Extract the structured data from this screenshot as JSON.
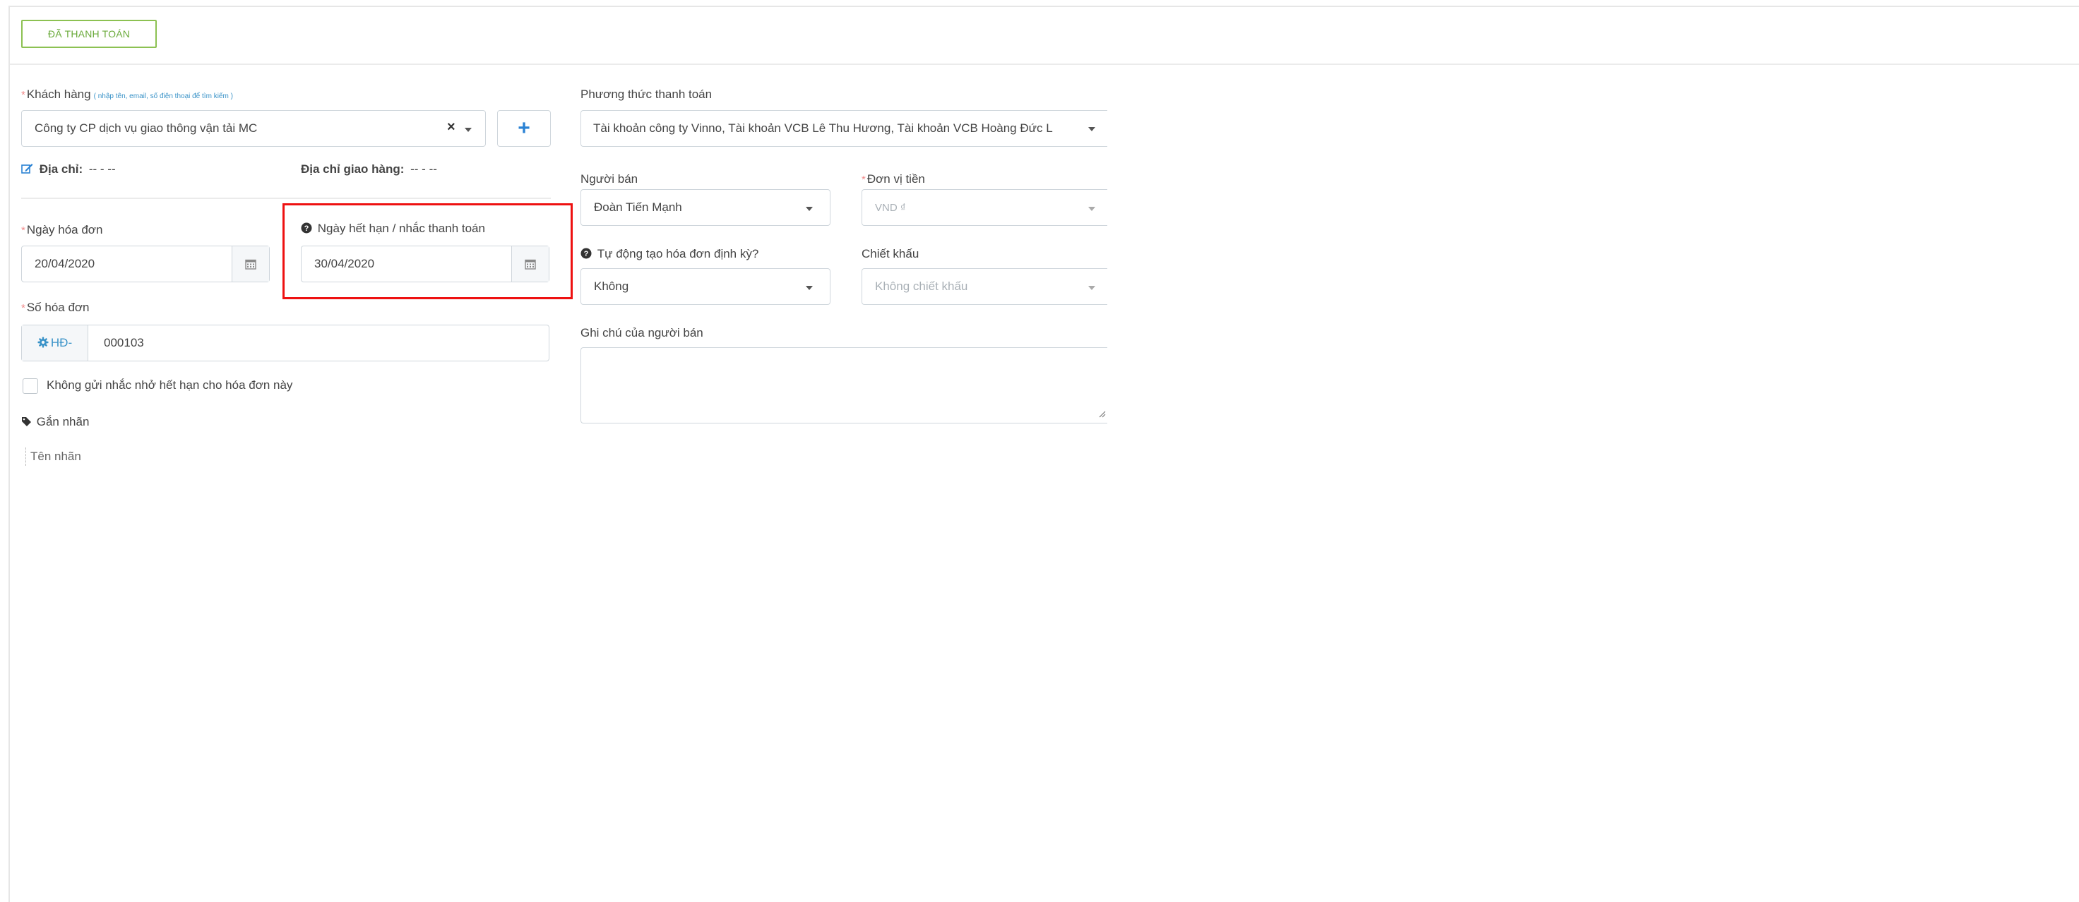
{
  "status_button": "ĐÃ THANH TOÁN",
  "customer": {
    "label": "Khách hàng",
    "hint": "( nhập tên, email, số điện thoại để tìm kiếm )",
    "value": "Công ty CP dịch vụ giao thông vận tải MC",
    "clear_glyph": "×",
    "add_glyph": "+"
  },
  "address": {
    "label": "Địa chỉ:",
    "value": "-- - --"
  },
  "shipping_address": {
    "label": "Địa chỉ giao hàng:",
    "value": "-- - --"
  },
  "invoice_date": {
    "label": "Ngày hóa đơn",
    "value": "20/04/2020"
  },
  "due_date": {
    "label": "Ngày hết hạn / nhắc thanh toán",
    "value": "30/04/2020"
  },
  "invoice_number": {
    "label": "Số hóa đơn",
    "prefix": "HĐ-",
    "value": "000103"
  },
  "no_reminder": {
    "label": "Không gửi nhắc nhở hết hạn cho hóa đơn này",
    "checked": false
  },
  "tags": {
    "label": "Gắn nhãn",
    "placeholder": "Tên nhãn"
  },
  "payment_method": {
    "label": "Phương thức thanh toán",
    "value": "Tài khoản công ty Vinno, Tài khoản VCB Lê Thu Hương, Tài khoản VCB Hoàng Đức L"
  },
  "seller": {
    "label": "Người bán",
    "value": "Đoàn Tiến Mạnh"
  },
  "currency": {
    "label": "Đơn vị tiền",
    "value": "VND ₫"
  },
  "recurring": {
    "label": "Tự động tạo hóa đơn định kỳ?",
    "value": "Không"
  },
  "discount": {
    "label": "Chiết khấu",
    "value": "Không chiết khấu"
  },
  "seller_note": {
    "label": "Ghi chú của người bán",
    "value": ""
  },
  "colors": {
    "paid_green": "#8cc152",
    "link_blue": "#2a82d4",
    "required_red": "#f18b8b",
    "highlight_red": "#ee1111"
  }
}
